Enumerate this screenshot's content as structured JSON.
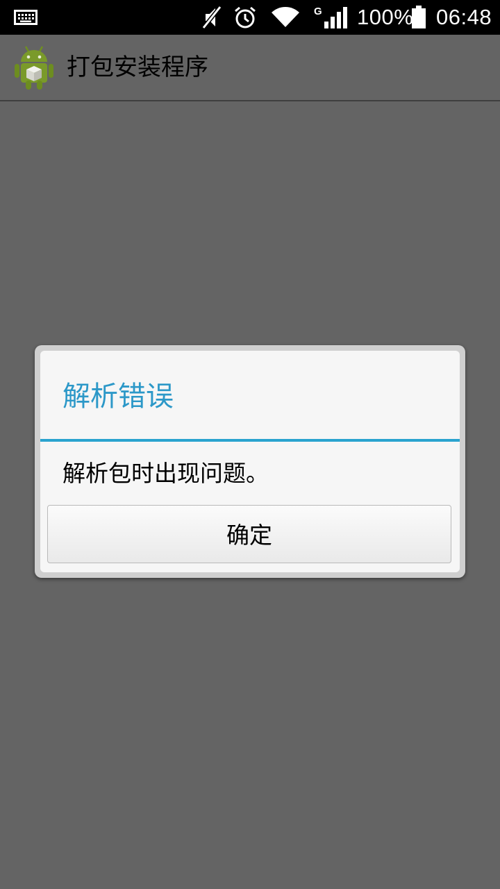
{
  "status_bar": {
    "network_type": "G",
    "battery_percent": "100%",
    "time": "06:48",
    "icons": [
      "keyboard-icon",
      "mute-icon",
      "alarm-icon",
      "wifi-icon",
      "signal-icon",
      "battery-icon"
    ]
  },
  "app_bar": {
    "title": "打包安装程序",
    "icon": "android-package-installer-icon"
  },
  "dialog": {
    "title": "解析错误",
    "message": "解析包时出现问题。",
    "ok_label": "确定"
  },
  "colors": {
    "accent": "#2aa3cf",
    "background": "#646464",
    "status_bar": "#000000"
  }
}
